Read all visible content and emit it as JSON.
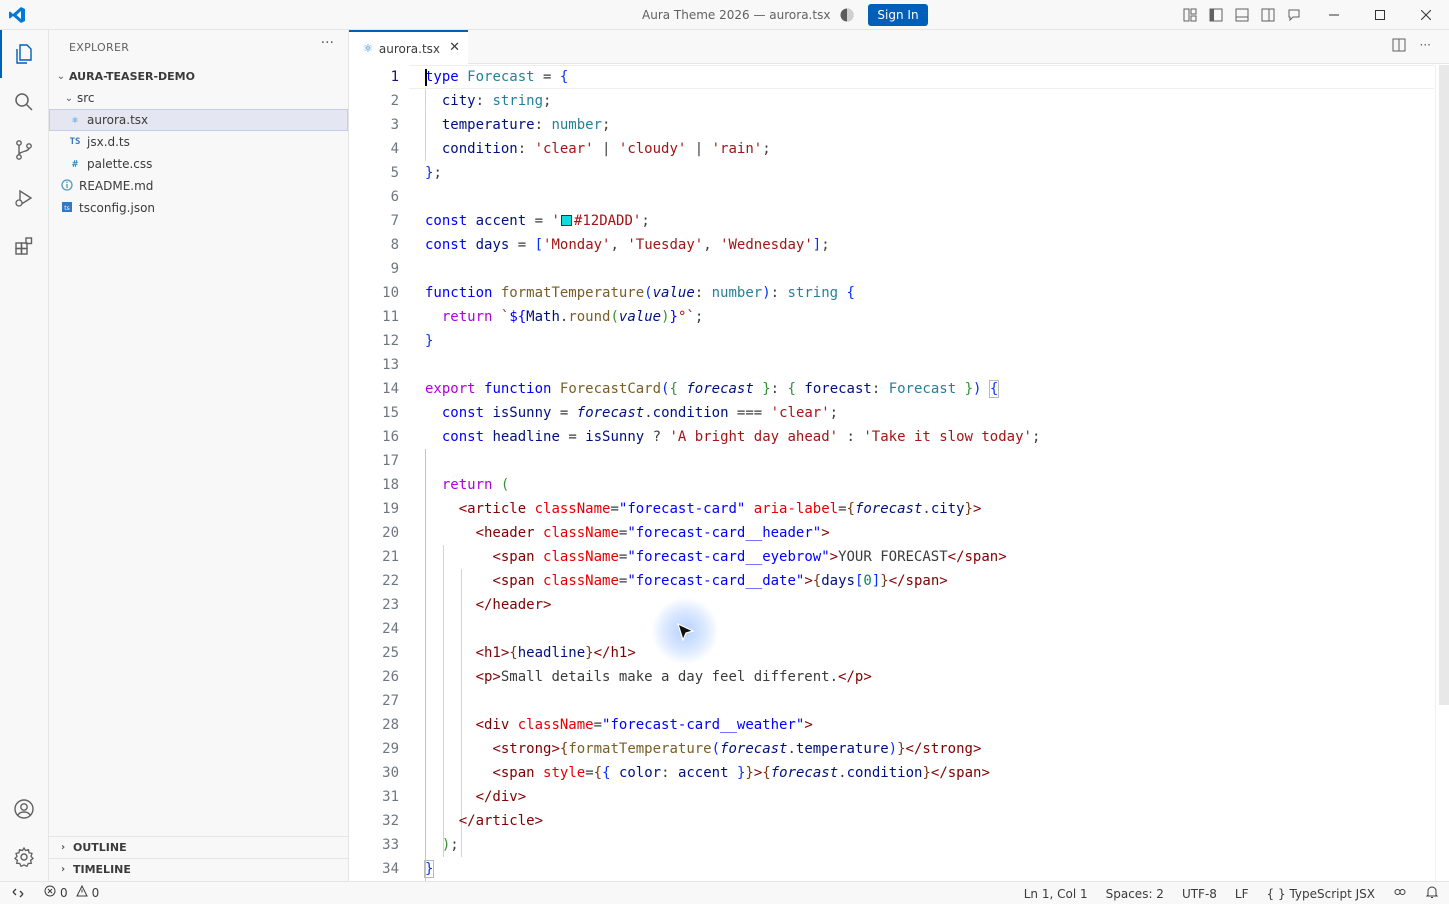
{
  "window": {
    "title": "Aura Theme 2026 — aurora.tsx",
    "sign_in": "Sign In"
  },
  "sidebar": {
    "header": "EXPLORER",
    "more": "···",
    "root": "AURA-TEASER-DEMO",
    "items": [
      {
        "label": "src",
        "icon": "folder-open-chevron"
      },
      {
        "label": "aurora.tsx",
        "icon": "react-icon"
      },
      {
        "label": "jsx.d.ts",
        "icon": "TS"
      },
      {
        "label": "palette.css",
        "icon": "#"
      },
      {
        "label": "README.md",
        "icon": "info-icon"
      },
      {
        "label": "tsconfig.json",
        "icon": "tsconfig-icon"
      }
    ],
    "outline": "OUTLINE",
    "timeline": "TIMELINE"
  },
  "editor": {
    "tab_label": "aurora.tsx",
    "tab_close": "✕",
    "tab_more": "···",
    "line_numbers": [
      "1",
      "2",
      "3",
      "4",
      "5",
      "6",
      "7",
      "8",
      "9",
      "10",
      "11",
      "12",
      "13",
      "14",
      "15",
      "16",
      "17",
      "18",
      "19",
      "20",
      "21",
      "22",
      "23",
      "24",
      "25",
      "26",
      "27",
      "28",
      "29",
      "30",
      "31",
      "32",
      "33",
      "34"
    ],
    "accent_swatch_color": "#12DADD"
  },
  "statusbar": {
    "errors": "0",
    "warnings": "0",
    "position": "Ln 1, Col 1",
    "spaces": "Spaces: 2",
    "encoding": "UTF-8",
    "eol": "LF",
    "language": "TypeScript JSX",
    "language_braces": "{ }"
  },
  "colors": {
    "accent": "#005fb8",
    "selection": "#e4e6f1"
  }
}
